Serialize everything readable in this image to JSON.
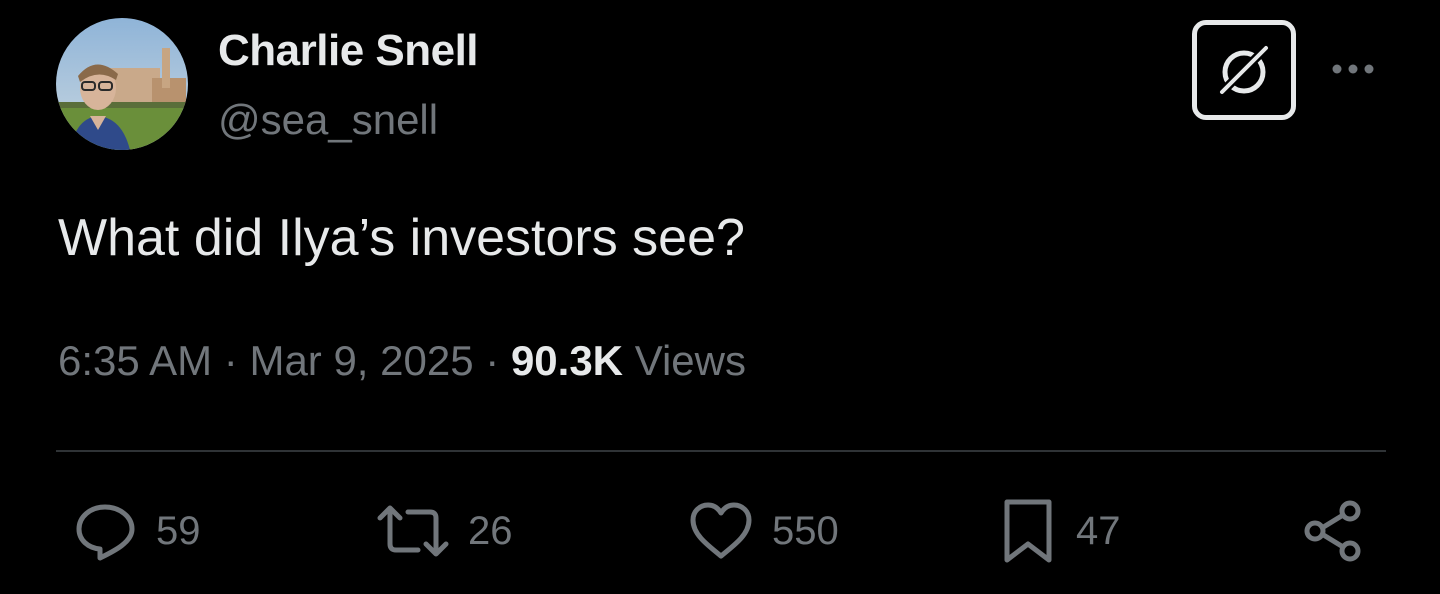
{
  "tweet": {
    "author": {
      "display_name": "Charlie Snell",
      "handle": "@sea_snell",
      "avatar": "profile-photo"
    },
    "text": "What did Ilya’s investors see?",
    "time": "6:35 AM",
    "date": "Mar 9, 2025",
    "separator": "·",
    "views_count": "90.3K",
    "views_label": "Views",
    "actions": {
      "replies": "59",
      "reposts": "26",
      "likes": "550",
      "bookmarks": "47"
    }
  },
  "icons": {
    "grok": "grok-icon",
    "more": "more-dots-icon",
    "reply": "reply-bubble-icon",
    "repost": "repost-arrows-icon",
    "like": "heart-icon",
    "bookmark": "bookmark-icon",
    "share": "share-icon"
  },
  "colors": {
    "background": "#000000",
    "primary_text": "#e7e9ea",
    "secondary_text": "#71767b",
    "divider": "#2f3336"
  }
}
